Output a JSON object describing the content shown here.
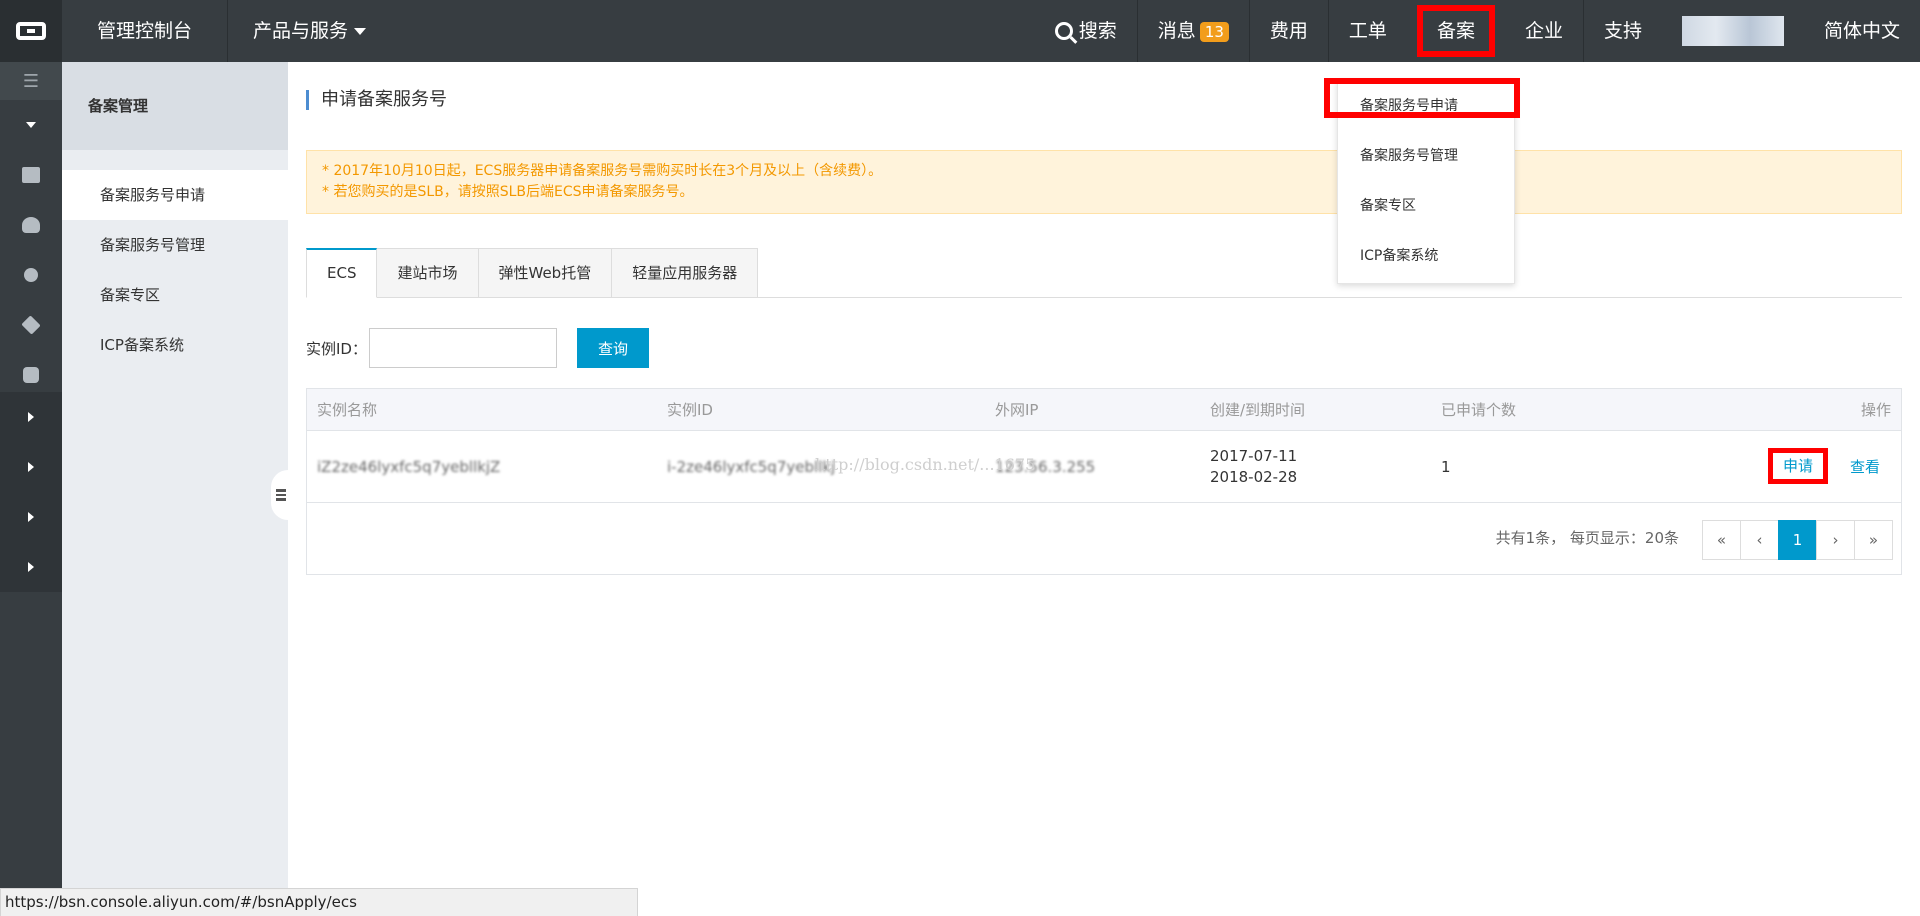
{
  "topbar": {
    "title": "管理控制台",
    "products": "产品与服务",
    "search": "搜索",
    "messages": "消息",
    "messages_count": "13",
    "billing": "费用",
    "tickets": "工单",
    "beian": "备案",
    "enterprise": "企业",
    "support": "支持",
    "language": "简体中文"
  },
  "sidebar": {
    "header": "备案管理",
    "items": [
      {
        "label": "备案服务号申请"
      },
      {
        "label": "备案服务号管理"
      },
      {
        "label": "备案专区"
      },
      {
        "label": "ICP备案系统"
      }
    ]
  },
  "main": {
    "title": "申请备案服务号",
    "notices": [
      "* 2017年10月10日起，ECS服务器申请备案服务号需购买时长在3个月及以上（含续费）。",
      "* 若您购买的是SLB，请按照SLB后端ECS申请备案服务号。"
    ],
    "tabs": [
      {
        "label": "ECS"
      },
      {
        "label": "建站市场"
      },
      {
        "label": "弹性Web托管"
      },
      {
        "label": "轻量应用服务器"
      }
    ],
    "query": {
      "label": "实例ID：",
      "value": "",
      "button": "查询"
    },
    "table": {
      "headers": [
        "实例名称",
        "实例ID",
        "外网IP",
        "创建/到期时间",
        "已申请个数",
        "操作"
      ],
      "row": {
        "name": "iZ2ze46lyxfc5q7yebllkjZ",
        "id": "i-2ze46lyxfc5q7yebllkj",
        "ip": "123.56.3.255",
        "created": "2017-07-11",
        "expires": "2018-02-28",
        "count": "1",
        "apply": "申请",
        "view": "查看"
      },
      "watermark": "http://blog.csdn.net/...1675"
    },
    "pagination": {
      "info": "共有1条， 每页显示：20条",
      "first": "«",
      "prev": "‹",
      "current": "1",
      "next": "›",
      "last": "»"
    }
  },
  "dropdown": {
    "items": [
      {
        "label": "备案服务号申请"
      },
      {
        "label": "备案服务号管理"
      },
      {
        "label": "备案专区"
      },
      {
        "label": "ICP备案系统"
      }
    ]
  },
  "statusbar": {
    "url": "https://bsn.console.aliyun.com/#/bsnApply/ecs"
  },
  "colors": {
    "topbar": "#373d41",
    "accent": "#0099cc",
    "highlight": "#ff0000",
    "notice_text": "#f39800",
    "badge": "#f29d1b"
  }
}
